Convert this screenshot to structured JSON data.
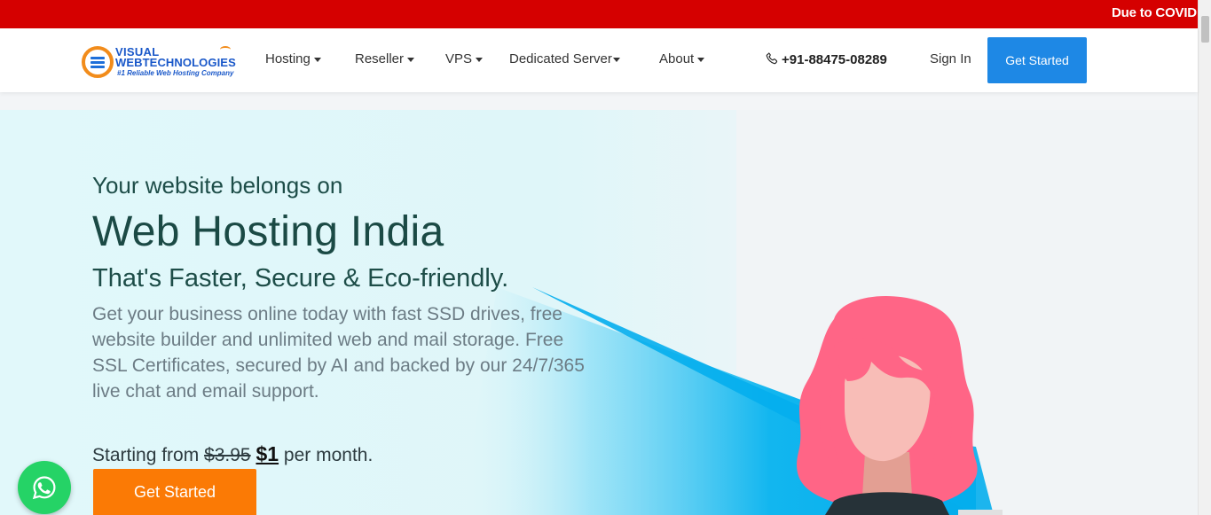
{
  "announcement": {
    "text": "Due to COVID"
  },
  "brand": {
    "line1": "VISUAL",
    "line2": "WEBTECHNOLOGIES",
    "tagline": "#1 Reliable Web Hosting Company",
    "logo_icon": "server-globe-icon"
  },
  "nav": {
    "items": [
      {
        "label": "Hosting"
      },
      {
        "label": "Reseller"
      },
      {
        "label": "VPS"
      },
      {
        "label": "Dedicated Server"
      },
      {
        "label": "About"
      }
    ],
    "phone": "+91-88475-08289",
    "phone_icon": "phone-icon",
    "sign_in": "Sign In",
    "cta": "Get Started"
  },
  "hero": {
    "kicker": "Your website belongs on",
    "title": "Web Hosting India",
    "subtitle": "That's Faster, Secure & Eco-friendly.",
    "description": "Get your business online today with fast SSD drives, free website builder and unlimited web and mail storage. Free SSL Certificates, secured by AI and backed by our 24/7/365 live chat and email support.",
    "price_prefix": "Starting from",
    "old_price": "$3.95",
    "new_price": "$1",
    "price_suffix": "per month.",
    "cta": "Get Started"
  },
  "widgets": {
    "whatsapp_icon": "whatsapp-icon"
  },
  "colors": {
    "announcement_bg": "#d50000",
    "primary_button": "#1e88e5",
    "hero_button": "#fb7a05",
    "heading": "#1b4a45",
    "beam": "#0db4ef",
    "hair": "#ff6586",
    "whatsapp": "#25d366"
  }
}
